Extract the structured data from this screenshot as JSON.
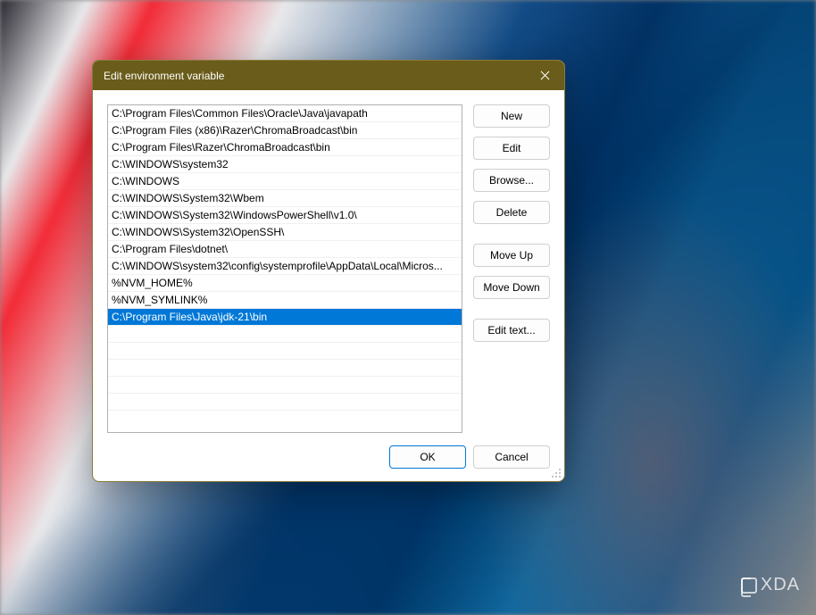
{
  "dialog": {
    "title": "Edit environment variable",
    "list": {
      "items": [
        "C:\\Program Files\\Common Files\\Oracle\\Java\\javapath",
        "C:\\Program Files (x86)\\Razer\\ChromaBroadcast\\bin",
        "C:\\Program Files\\Razer\\ChromaBroadcast\\bin",
        "C:\\WINDOWS\\system32",
        "C:\\WINDOWS",
        "C:\\WINDOWS\\System32\\Wbem",
        "C:\\WINDOWS\\System32\\WindowsPowerShell\\v1.0\\",
        "C:\\WINDOWS\\System32\\OpenSSH\\",
        "C:\\Program Files\\dotnet\\",
        "C:\\WINDOWS\\system32\\config\\systemprofile\\AppData\\Local\\Micros...",
        "%NVM_HOME%",
        "%NVM_SYMLINK%",
        "C:\\Program Files\\Java\\jdk-21\\bin"
      ],
      "selectedIndex": 12
    },
    "buttons": {
      "new": "New",
      "edit": "Edit",
      "browse": "Browse...",
      "delete": "Delete",
      "moveUp": "Move Up",
      "moveDown": "Move Down",
      "editText": "Edit text...",
      "ok": "OK",
      "cancel": "Cancel"
    }
  },
  "watermark": {
    "text": "XDA"
  }
}
